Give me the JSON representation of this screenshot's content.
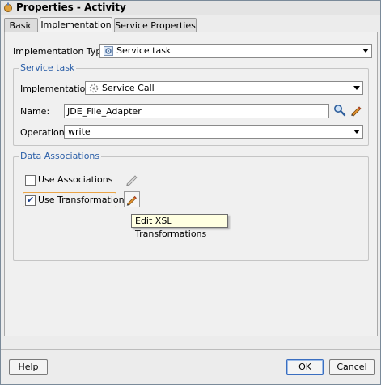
{
  "window": {
    "title": "Properties - Activity"
  },
  "tabs": [
    {
      "label": "Basic"
    },
    {
      "label": "Implementation",
      "active": true
    },
    {
      "label": "Service Properties"
    }
  ],
  "implementation_type": {
    "label": "Implementation Type:",
    "value": "Service task",
    "icon": "gear-icon"
  },
  "service_task": {
    "legend": "Service task",
    "implementation": {
      "label": "Implementation:",
      "value": "Service Call",
      "icon": "gear-icon"
    },
    "name": {
      "label": "Name:",
      "value": "JDE_File_Adapter"
    },
    "operation": {
      "label": "Operation:",
      "value": "write"
    }
  },
  "data_associations": {
    "legend": "Data Associations",
    "use_associations": {
      "label": "Use Associations",
      "checked": false
    },
    "use_transformations": {
      "label": "Use Transformations",
      "checked": true
    }
  },
  "tooltip": {
    "text": "Edit XSL Transformations"
  },
  "buttons": {
    "help": "Help",
    "ok": "OK",
    "cancel": "Cancel"
  },
  "colors": {
    "legend": "#2b5fa8",
    "tooltip_bg": "#ffffe1",
    "focus": "#e9a447"
  }
}
